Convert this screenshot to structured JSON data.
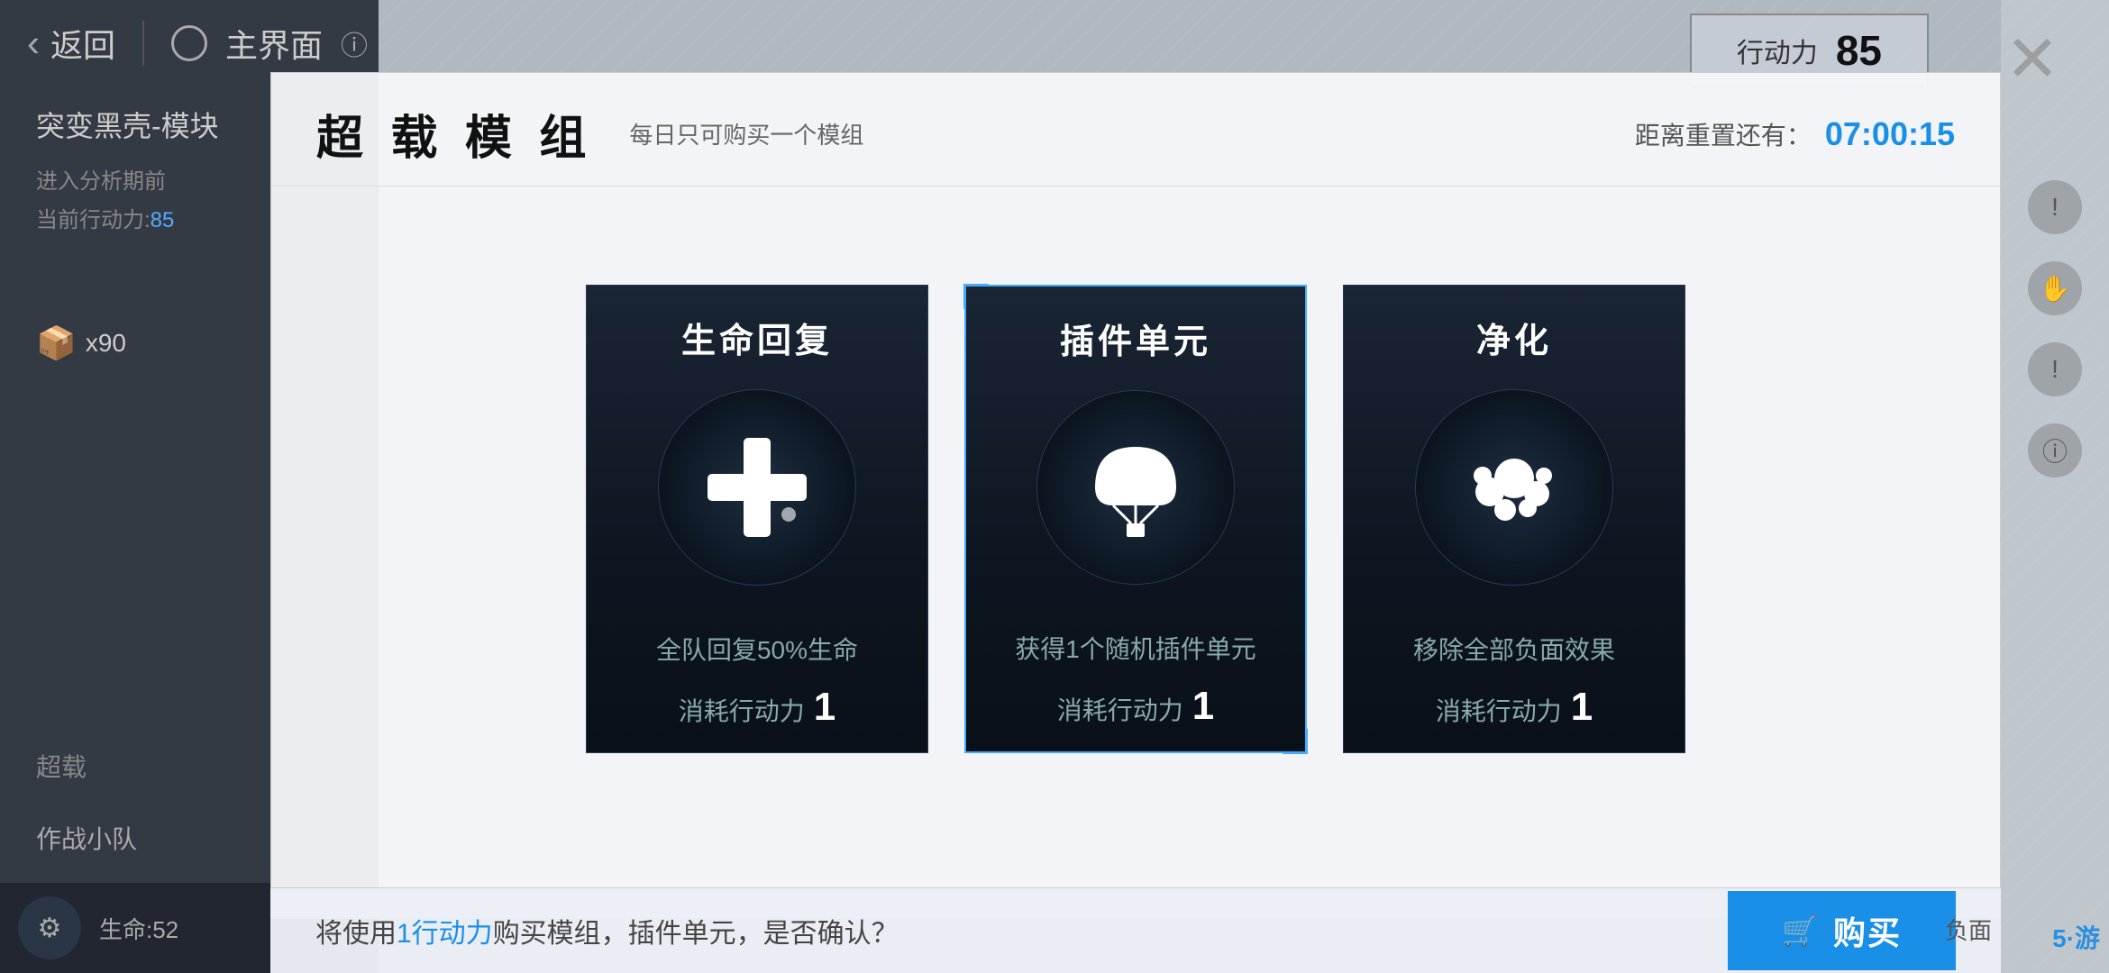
{
  "nav": {
    "back_label": "返回",
    "main_label": "主界面"
  },
  "action_points": {
    "label": "行动力",
    "value": "85"
  },
  "dialog": {
    "title": "超 载 模 组",
    "subtitle": "每日只可购买一个模组",
    "timer_label": "距离重置还有：",
    "timer_value": "07:00:15"
  },
  "cards": [
    {
      "id": "heal",
      "title": "生命回复",
      "description": "全队回复50%生命",
      "cost_label": "消耗行动力",
      "cost_value": "1",
      "selected": false
    },
    {
      "id": "plugin",
      "title": "插件单元",
      "description": "获得1个随机插件单元",
      "cost_label": "消耗行动力",
      "cost_value": "1",
      "selected": true
    },
    {
      "id": "purify",
      "title": "净化",
      "description": "移除全部负面效果",
      "cost_label": "消耗行动力",
      "cost_value": "1",
      "selected": false
    }
  ],
  "bottom_bar": {
    "confirm_text_before": "将使用",
    "confirm_highlight": "1行动力",
    "confirm_text_after": "购买模组，插件单元，是否确认？",
    "buy_label": "购买"
  },
  "sidebar": {
    "game_title": "突变黑壳-模块",
    "info_line1": "进入分析期前",
    "info_line2": "当前行动力:",
    "current_ap": "85",
    "item_count": "x90",
    "section_label": "超载",
    "squad_label": "作战小队"
  },
  "bottom_status": {
    "hp_label": "生命:52"
  },
  "right_panel": {
    "icons": [
      "!",
      "hand",
      "!",
      "info"
    ]
  },
  "bottom_corner": {
    "label": "负面"
  },
  "watermark": "5·游"
}
